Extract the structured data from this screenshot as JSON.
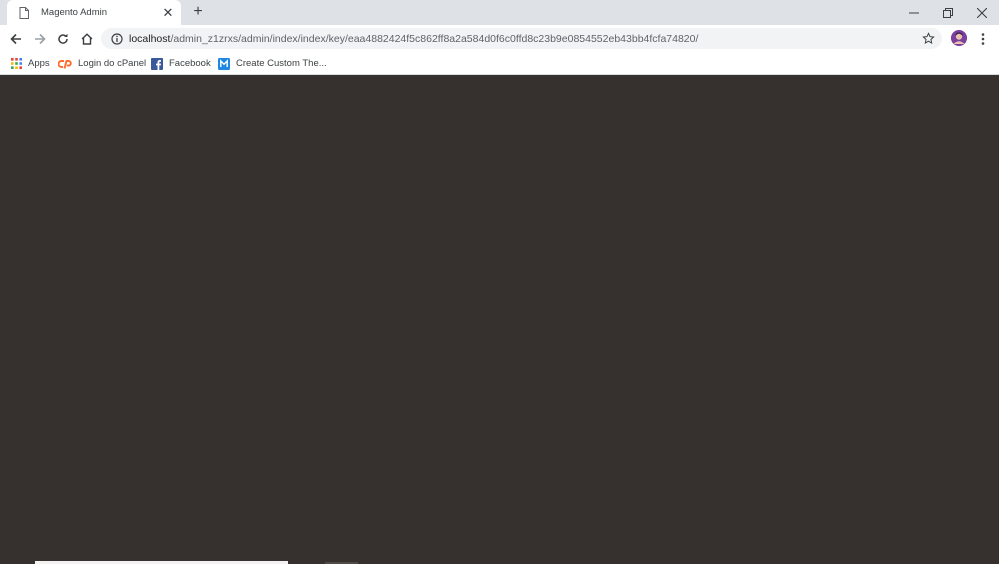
{
  "tab": {
    "title": "Magento Admin",
    "favicon": "page-icon",
    "close": "✕"
  },
  "new_tab_label": "+",
  "window_controls": {
    "minimize": "─",
    "restore": "❐",
    "close": "✕"
  },
  "address_bar": {
    "host": "localhost",
    "path": "/admin_z1zrxs/admin/index/index/key/eaa4882424f5c862ff8a2a584d0f6c0ffd8c23b9e0854552eb43bb4fcfa74820/"
  },
  "bookmarks": [
    {
      "label": "Apps",
      "icon": "apps-grid-icon"
    },
    {
      "label": "Login do cPanel",
      "icon": "cpanel-icon"
    },
    {
      "label": "Facebook",
      "icon": "facebook-icon"
    },
    {
      "label": "Create Custom The...",
      "icon": "magento-icon"
    }
  ],
  "colors": {
    "content_background": "#36312e",
    "tab_strip": "#dee1e6",
    "omnibox": "#f1f3f4"
  }
}
